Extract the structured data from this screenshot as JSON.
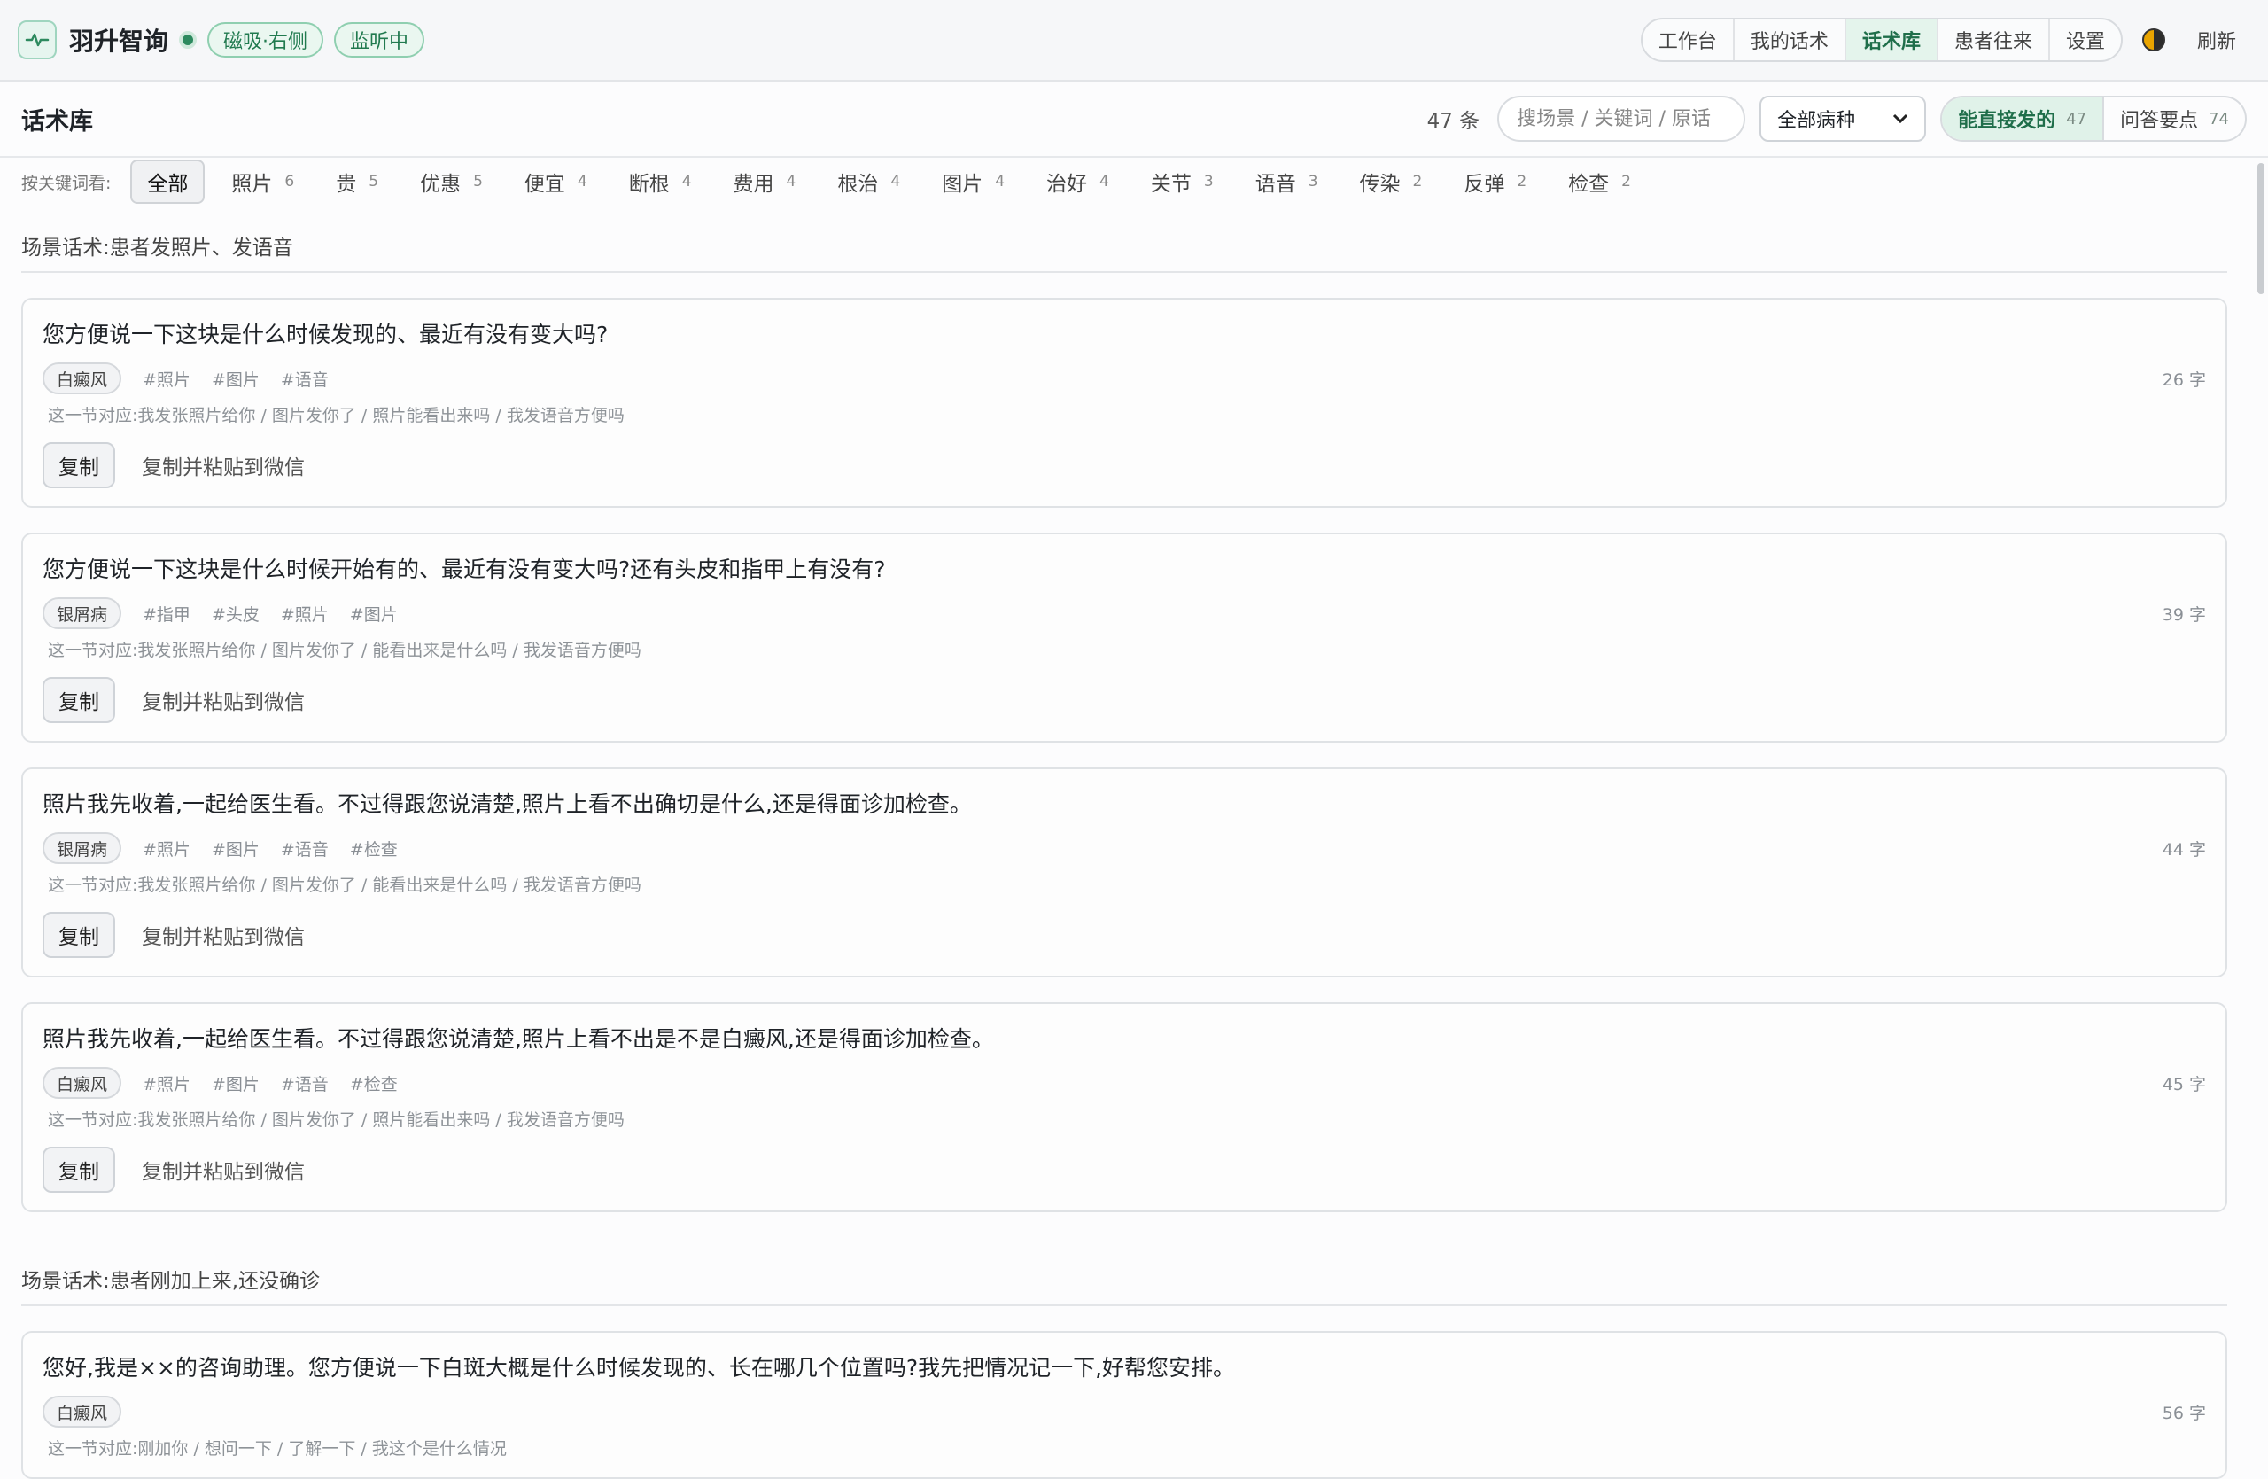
{
  "app": {
    "name": "羽升智询",
    "dock_badge": "磁吸·右侧",
    "listen_badge": "监听中",
    "nav": [
      "工作台",
      "我的话术",
      "话术库",
      "患者往来",
      "设置"
    ],
    "active_nav_index": 2,
    "refresh_label": "刷新"
  },
  "header": {
    "title": "话术库",
    "count": "47 条",
    "search_placeholder": "搜场景 / 关键词 / 原话",
    "disease_select": "全部病种",
    "modes": [
      {
        "label": "能直接发的",
        "count": "47",
        "active": true
      },
      {
        "label": "问答要点",
        "count": "74",
        "active": false
      }
    ]
  },
  "keywords": {
    "label": "按关键词看:",
    "items": [
      {
        "label": "全部",
        "count": "",
        "active": true
      },
      {
        "label": "照片",
        "count": "6"
      },
      {
        "label": "贵",
        "count": "5"
      },
      {
        "label": "优惠",
        "count": "5"
      },
      {
        "label": "便宜",
        "count": "4"
      },
      {
        "label": "断根",
        "count": "4"
      },
      {
        "label": "费用",
        "count": "4"
      },
      {
        "label": "根治",
        "count": "4"
      },
      {
        "label": "图片",
        "count": "4"
      },
      {
        "label": "治好",
        "count": "4"
      },
      {
        "label": "关节",
        "count": "3"
      },
      {
        "label": "语音",
        "count": "3"
      },
      {
        "label": "传染",
        "count": "2"
      },
      {
        "label": "反弹",
        "count": "2"
      },
      {
        "label": "检查",
        "count": "2"
      }
    ]
  },
  "actions": {
    "copy": "复制",
    "paste": "复制并粘贴到微信"
  },
  "sections": [
    {
      "title": "场景话术:患者发照片、发语音",
      "cards": [
        {
          "text": "您方便说一下这块是什么时候发现的、最近有没有变大吗?",
          "disease": "白癜风",
          "tags": [
            "#照片",
            "#图片",
            "#语音"
          ],
          "chars": "26 字",
          "hint": "这一节对应:我发张照片给你 / 图片发你了 / 照片能看出来吗 / 我发语音方便吗",
          "show_actions": true
        },
        {
          "text": "您方便说一下这块是什么时候开始有的、最近有没有变大吗?还有头皮和指甲上有没有?",
          "disease": "银屑病",
          "tags": [
            "#指甲",
            "#头皮",
            "#照片",
            "#图片"
          ],
          "chars": "39 字",
          "hint": "这一节对应:我发张照片给你 / 图片发你了 / 能看出来是什么吗 / 我发语音方便吗",
          "show_actions": true
        },
        {
          "text": "照片我先收着,一起给医生看。不过得跟您说清楚,照片上看不出确切是什么,还是得面诊加检查。",
          "disease": "银屑病",
          "tags": [
            "#照片",
            "#图片",
            "#语音",
            "#检查"
          ],
          "chars": "44 字",
          "hint": "这一节对应:我发张照片给你 / 图片发你了 / 能看出来是什么吗 / 我发语音方便吗",
          "show_actions": true
        },
        {
          "text": "照片我先收着,一起给医生看。不过得跟您说清楚,照片上看不出是不是白癜风,还是得面诊加检查。",
          "disease": "白癜风",
          "tags": [
            "#照片",
            "#图片",
            "#语音",
            "#检查"
          ],
          "chars": "45 字",
          "hint": "这一节对应:我发张照片给你 / 图片发你了 / 照片能看出来吗 / 我发语音方便吗",
          "show_actions": true
        }
      ]
    },
    {
      "title": "场景话术:患者刚加上来,还没确诊",
      "cards": [
        {
          "text": "您好,我是××的咨询助理。您方便说一下白斑大概是什么时候发现的、长在哪几个位置吗?我先把情况记一下,好帮您安排。",
          "disease": "白癜风",
          "tags": [],
          "chars": "56 字",
          "hint": "这一节对应:刚加你 / 想问一下 / 了解一下 / 我这个是什么情况",
          "show_actions": false
        }
      ]
    }
  ]
}
